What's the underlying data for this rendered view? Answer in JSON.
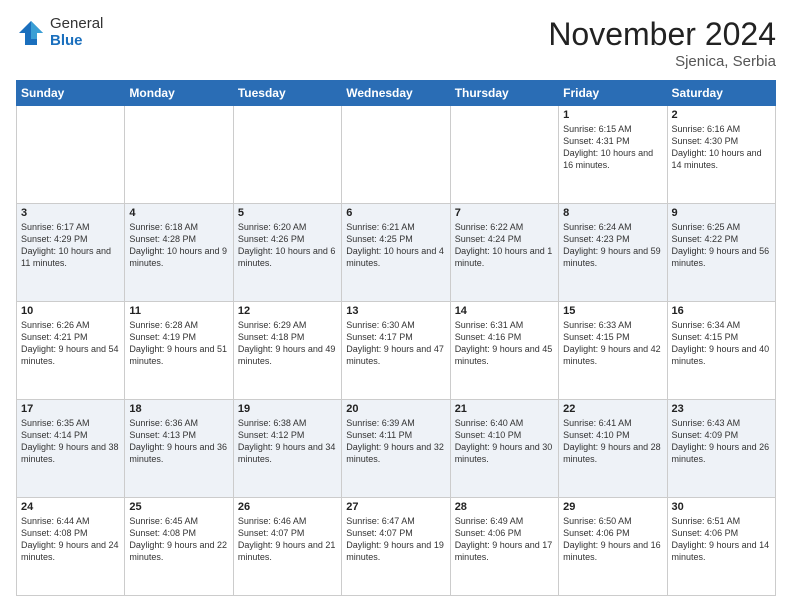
{
  "header": {
    "logo_general": "General",
    "logo_blue": "Blue",
    "month_title": "November 2024",
    "location": "Sjenica, Serbia"
  },
  "days_of_week": [
    "Sunday",
    "Monday",
    "Tuesday",
    "Wednesday",
    "Thursday",
    "Friday",
    "Saturday"
  ],
  "weeks": [
    [
      {
        "num": "",
        "info": ""
      },
      {
        "num": "",
        "info": ""
      },
      {
        "num": "",
        "info": ""
      },
      {
        "num": "",
        "info": ""
      },
      {
        "num": "",
        "info": ""
      },
      {
        "num": "1",
        "info": "Sunrise: 6:15 AM\nSunset: 4:31 PM\nDaylight: 10 hours and 16 minutes."
      },
      {
        "num": "2",
        "info": "Sunrise: 6:16 AM\nSunset: 4:30 PM\nDaylight: 10 hours and 14 minutes."
      }
    ],
    [
      {
        "num": "3",
        "info": "Sunrise: 6:17 AM\nSunset: 4:29 PM\nDaylight: 10 hours and 11 minutes."
      },
      {
        "num": "4",
        "info": "Sunrise: 6:18 AM\nSunset: 4:28 PM\nDaylight: 10 hours and 9 minutes."
      },
      {
        "num": "5",
        "info": "Sunrise: 6:20 AM\nSunset: 4:26 PM\nDaylight: 10 hours and 6 minutes."
      },
      {
        "num": "6",
        "info": "Sunrise: 6:21 AM\nSunset: 4:25 PM\nDaylight: 10 hours and 4 minutes."
      },
      {
        "num": "7",
        "info": "Sunrise: 6:22 AM\nSunset: 4:24 PM\nDaylight: 10 hours and 1 minute."
      },
      {
        "num": "8",
        "info": "Sunrise: 6:24 AM\nSunset: 4:23 PM\nDaylight: 9 hours and 59 minutes."
      },
      {
        "num": "9",
        "info": "Sunrise: 6:25 AM\nSunset: 4:22 PM\nDaylight: 9 hours and 56 minutes."
      }
    ],
    [
      {
        "num": "10",
        "info": "Sunrise: 6:26 AM\nSunset: 4:21 PM\nDaylight: 9 hours and 54 minutes."
      },
      {
        "num": "11",
        "info": "Sunrise: 6:28 AM\nSunset: 4:19 PM\nDaylight: 9 hours and 51 minutes."
      },
      {
        "num": "12",
        "info": "Sunrise: 6:29 AM\nSunset: 4:18 PM\nDaylight: 9 hours and 49 minutes."
      },
      {
        "num": "13",
        "info": "Sunrise: 6:30 AM\nSunset: 4:17 PM\nDaylight: 9 hours and 47 minutes."
      },
      {
        "num": "14",
        "info": "Sunrise: 6:31 AM\nSunset: 4:16 PM\nDaylight: 9 hours and 45 minutes."
      },
      {
        "num": "15",
        "info": "Sunrise: 6:33 AM\nSunset: 4:15 PM\nDaylight: 9 hours and 42 minutes."
      },
      {
        "num": "16",
        "info": "Sunrise: 6:34 AM\nSunset: 4:15 PM\nDaylight: 9 hours and 40 minutes."
      }
    ],
    [
      {
        "num": "17",
        "info": "Sunrise: 6:35 AM\nSunset: 4:14 PM\nDaylight: 9 hours and 38 minutes."
      },
      {
        "num": "18",
        "info": "Sunrise: 6:36 AM\nSunset: 4:13 PM\nDaylight: 9 hours and 36 minutes."
      },
      {
        "num": "19",
        "info": "Sunrise: 6:38 AM\nSunset: 4:12 PM\nDaylight: 9 hours and 34 minutes."
      },
      {
        "num": "20",
        "info": "Sunrise: 6:39 AM\nSunset: 4:11 PM\nDaylight: 9 hours and 32 minutes."
      },
      {
        "num": "21",
        "info": "Sunrise: 6:40 AM\nSunset: 4:10 PM\nDaylight: 9 hours and 30 minutes."
      },
      {
        "num": "22",
        "info": "Sunrise: 6:41 AM\nSunset: 4:10 PM\nDaylight: 9 hours and 28 minutes."
      },
      {
        "num": "23",
        "info": "Sunrise: 6:43 AM\nSunset: 4:09 PM\nDaylight: 9 hours and 26 minutes."
      }
    ],
    [
      {
        "num": "24",
        "info": "Sunrise: 6:44 AM\nSunset: 4:08 PM\nDaylight: 9 hours and 24 minutes."
      },
      {
        "num": "25",
        "info": "Sunrise: 6:45 AM\nSunset: 4:08 PM\nDaylight: 9 hours and 22 minutes."
      },
      {
        "num": "26",
        "info": "Sunrise: 6:46 AM\nSunset: 4:07 PM\nDaylight: 9 hours and 21 minutes."
      },
      {
        "num": "27",
        "info": "Sunrise: 6:47 AM\nSunset: 4:07 PM\nDaylight: 9 hours and 19 minutes."
      },
      {
        "num": "28",
        "info": "Sunrise: 6:49 AM\nSunset: 4:06 PM\nDaylight: 9 hours and 17 minutes."
      },
      {
        "num": "29",
        "info": "Sunrise: 6:50 AM\nSunset: 4:06 PM\nDaylight: 9 hours and 16 minutes."
      },
      {
        "num": "30",
        "info": "Sunrise: 6:51 AM\nSunset: 4:06 PM\nDaylight: 9 hours and 14 minutes."
      }
    ]
  ]
}
